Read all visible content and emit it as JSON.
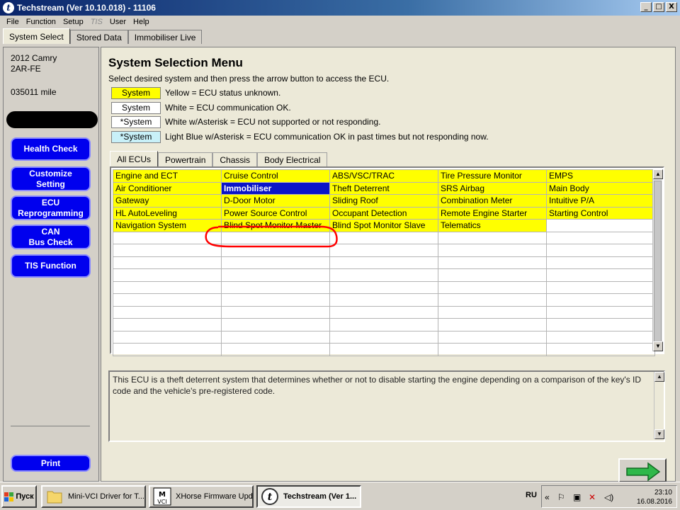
{
  "window": {
    "title": "Techstream (Ver 10.10.018) - 11106",
    "controls": [
      "_",
      "□",
      "X"
    ]
  },
  "menu": [
    "File",
    "Function",
    "Setup",
    "TIS",
    "User",
    "Help"
  ],
  "top_tabs": [
    "System Select",
    "Stored Data",
    "Immobiliser Live"
  ],
  "vehicle": {
    "model": "2012 Camry",
    "engine": "2AR-FE",
    "mileage": "035011 mile"
  },
  "sidebar_buttons": {
    "health_check": "Health Check",
    "customize_line1": "Customize",
    "customize_line2": "Setting",
    "ecu_line1": "ECU",
    "ecu_line2": "Reprogramming",
    "can_line1": "CAN",
    "can_line2": "Bus Check",
    "tis_function": "TIS Function",
    "print": "Print"
  },
  "main": {
    "title": "System Selection Menu",
    "instruction": "Select desired system and then press the arrow button to access the ECU.",
    "legend": [
      {
        "box": "System",
        "text": "Yellow = ECU status unknown.",
        "color": "#ffff00"
      },
      {
        "box": "System",
        "text": "White = ECU communication OK.",
        "color": "#ffffff"
      },
      {
        "box": "*System",
        "text": "White w/Asterisk = ECU not supported or not responding.",
        "color": "#ffffff"
      },
      {
        "box": "*System",
        "text": "Light Blue w/Asterisk = ECU communication OK in past times but not responding now.",
        "color": "#c8f0f8"
      }
    ],
    "ecu_tabs": [
      "All ECUs",
      "Powertrain",
      "Chassis",
      "Body Electrical"
    ],
    "ecu_grid": [
      [
        "Engine and ECT",
        "Cruise Control",
        "ABS/VSC/TRAC",
        "Tire Pressure Monitor",
        "EMPS"
      ],
      [
        "Air Conditioner",
        "Immobiliser",
        "Theft Deterrent",
        "SRS Airbag",
        "Main Body"
      ],
      [
        "Gateway",
        "D-Door Motor",
        "Sliding Roof",
        "Combination Meter",
        "Intuitive P/A"
      ],
      [
        "HL AutoLeveling",
        "Power Source Control",
        "Occupant Detection",
        "Remote Engine Starter",
        "Starting Control"
      ],
      [
        "Navigation System",
        "Blind Spot Monitor Master",
        "Blind Spot Monitor Slave",
        "Telematics",
        ""
      ]
    ],
    "selected_ecu": "Immobiliser",
    "description": "This ECU is a theft deterrent system that determines whether or not to disable starting the engine depending on a comparison of the key's ID code and the vehicle's pre-registered code."
  },
  "taskbar": {
    "start": "Пуск",
    "items": [
      "Mini-VCI Driver for T...",
      "XHorse Firmware Upd...",
      "Techstream (Ver 1..."
    ],
    "lang": "RU",
    "time": "23:10",
    "date": "16.08.2016"
  },
  "colors": {
    "status_unknown": "#ffff00",
    "selection": "#0a14c8",
    "sidebar_button": "#0000ee",
    "annotation_circle": "#ff0000"
  }
}
